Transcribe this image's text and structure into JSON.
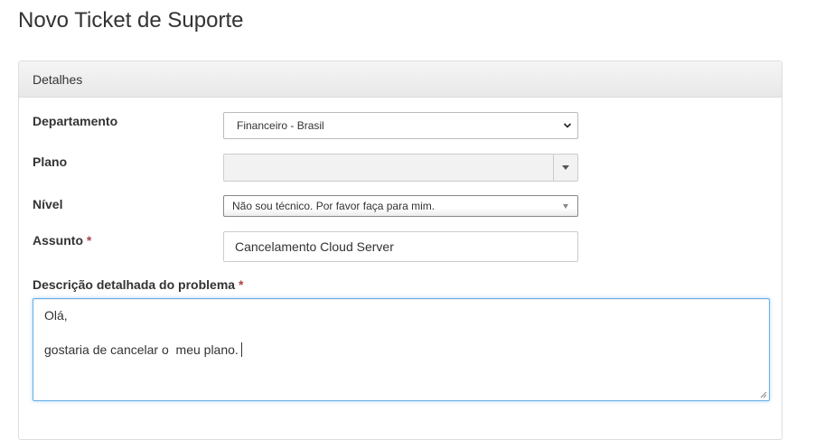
{
  "page": {
    "title": "Novo Ticket de Suporte"
  },
  "panel": {
    "heading": "Detalhes"
  },
  "form": {
    "departamento": {
      "label": "Departamento",
      "value": "Financeiro - Brasil"
    },
    "plano": {
      "label": "Plano",
      "value": ""
    },
    "nivel": {
      "label": "Nível",
      "value": "Não sou técnico. Por favor faça para mim."
    },
    "assunto": {
      "label": "Assunto",
      "required_mark": "*",
      "value": "Cancelamento Cloud Server"
    },
    "descricao": {
      "label": "Descrição detalhada do problema",
      "required_mark": "*",
      "lines": [
        "Olá,",
        "",
        "gostaria de cancelar o  meu plano."
      ]
    }
  },
  "colors": {
    "required": "#a94442",
    "focus_border": "#66afe9"
  },
  "icons": {
    "select_arrow": "chevron-down-icon",
    "plano_caret": "caret-down-icon",
    "resize": "resize-grip-icon"
  }
}
